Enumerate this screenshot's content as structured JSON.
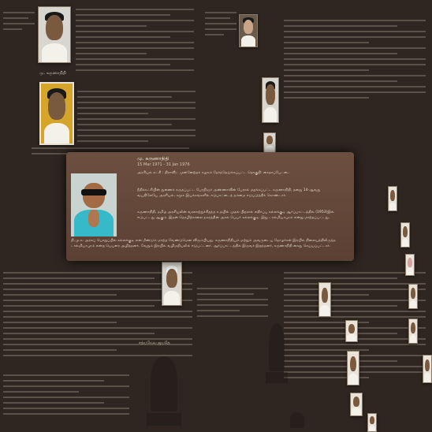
{
  "popup": {
    "name": "மு. கருணாநிதி",
    "dates": "15 Mar 1971 - 31 Jan 1976",
    "para1": "அரசியல் கட்சி : திராவிட முன்னேற்றக் கழகம் தேர்ந்தெடுக்கப்பட்ட தொகுதி: சைதாப்பேட்டை",
    "para2": "நீதிக்கட்சியின் துணைக் கருதப்பட்ட பேரறிஞர் அண்ணாவின் பேரால் மறக்கப்பட்ட கருணாநிதி, தனது 14-ஆவது வயதிலேயே அரசியல், சமூக இயக்கங்களில் ஈடுபாட்டைத் தம்மை ஈடுபடுத்திக் கொண்டார்.",
    "para3": "கருணாநிதி, தமிழ் அரசியலின் வரலாற்றுச்சிறந்த உதயில் முதல் பிறரால் எதிர்ப்பு கல்லக்குடி ஆர்ப்பாட்டத்தில் (1953)இல் ஈடுபட்டது ஆகும். இதன் தொழிற்சாலை நகரத்தின் அசல் பெயர் கல்லக்குடி. இது டால்மியாபுரம் என்று மாற்றப்பட்டது.",
    "para4": "தி.மு.க. அரசுப் பொறுப்பில் கல்லக்குடி என மீண்டும் மாற்ற வேண்டுமென விரும்பியது. கருணாநிதியும் மற்றும் அவருடைய தோழர்கள் இரயில் நிலையத்திலிருந்த டால்மியாபுரம் என்ற பெயரை அழித்தனர். வேறும் இரயில் வழிமறியலில் ஈடுபட்டனர். ஆர்ப்பாட்டத்தில் இருவர் இறந்தனர், கருணாநிதி கைது செய்யப்பட்டார்."
  },
  "labels": {
    "top_left_caption": "மு. கருணாநிதி",
    "emblem_caption": "சத்யமேவ ஜயதே"
  }
}
